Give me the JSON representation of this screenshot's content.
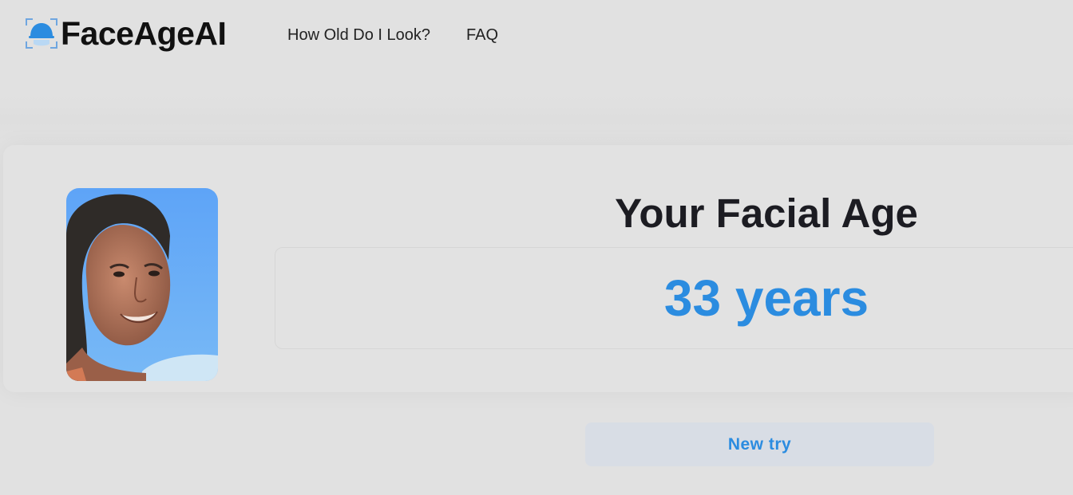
{
  "brand": {
    "name": "FaceAgeAI",
    "icon": "face-scan-icon",
    "accent_color": "#2b8ce0"
  },
  "nav": {
    "items": [
      {
        "label": "How Old Do I Look?"
      },
      {
        "label": "FAQ"
      }
    ]
  },
  "result": {
    "photo": "uploaded-face-photo",
    "title": "Your Facial Age",
    "age": "33 years"
  },
  "actions": {
    "new_try_label": "New try"
  }
}
